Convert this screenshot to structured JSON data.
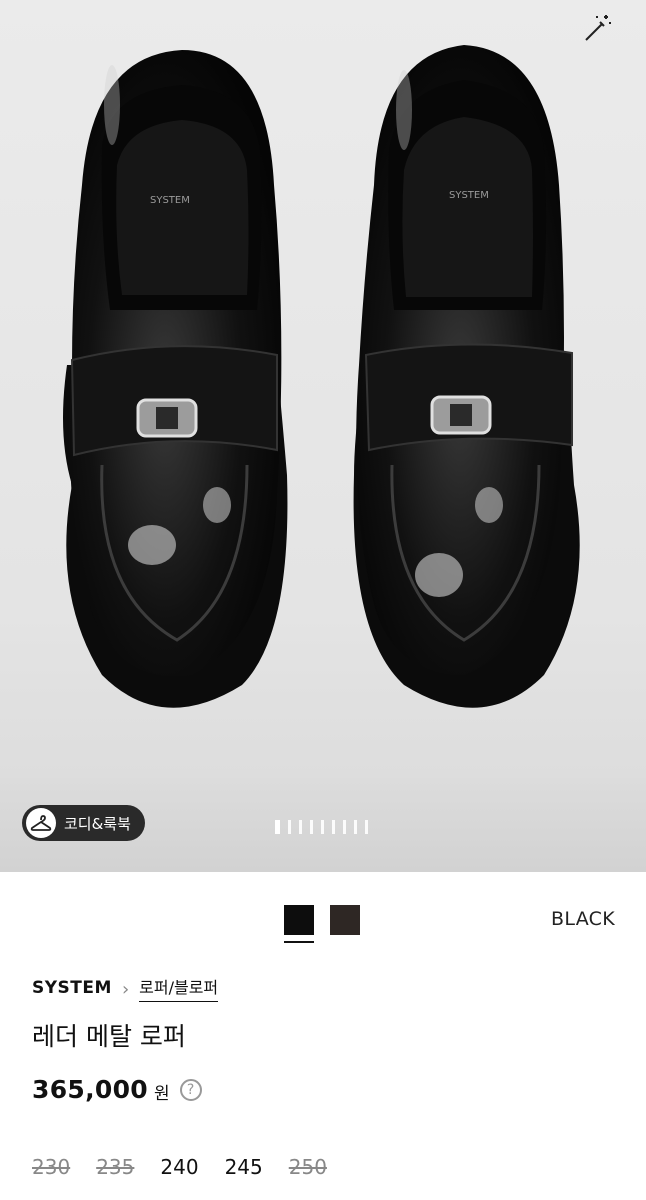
{
  "hero": {
    "image_alt": "SYSTEM leather metal loafer pair",
    "insole_text": "SYSTEM",
    "look_button_label": "코디&룩북",
    "carousel": {
      "total": 9,
      "current": 1
    }
  },
  "icons": {
    "magic": "magic-wand-icon",
    "hanger": "hanger-icon",
    "help": "question-icon"
  },
  "colors": {
    "swatches": [
      {
        "name": "black",
        "hex": "#0d0d0d",
        "selected": true
      },
      {
        "name": "brown",
        "hex": "#2e2724",
        "selected": false
      }
    ],
    "selected_label": "BLACK"
  },
  "product": {
    "brand": "SYSTEM",
    "category": "로퍼/블로퍼",
    "name": "레더 메탈 로퍼",
    "price": "365,000",
    "currency": "원",
    "help": "?"
  },
  "sizes": [
    {
      "label": "230",
      "sold_out": true
    },
    {
      "label": "235",
      "sold_out": true
    },
    {
      "label": "240",
      "sold_out": false
    },
    {
      "label": "245",
      "sold_out": false
    },
    {
      "label": "250",
      "sold_out": true
    }
  ]
}
